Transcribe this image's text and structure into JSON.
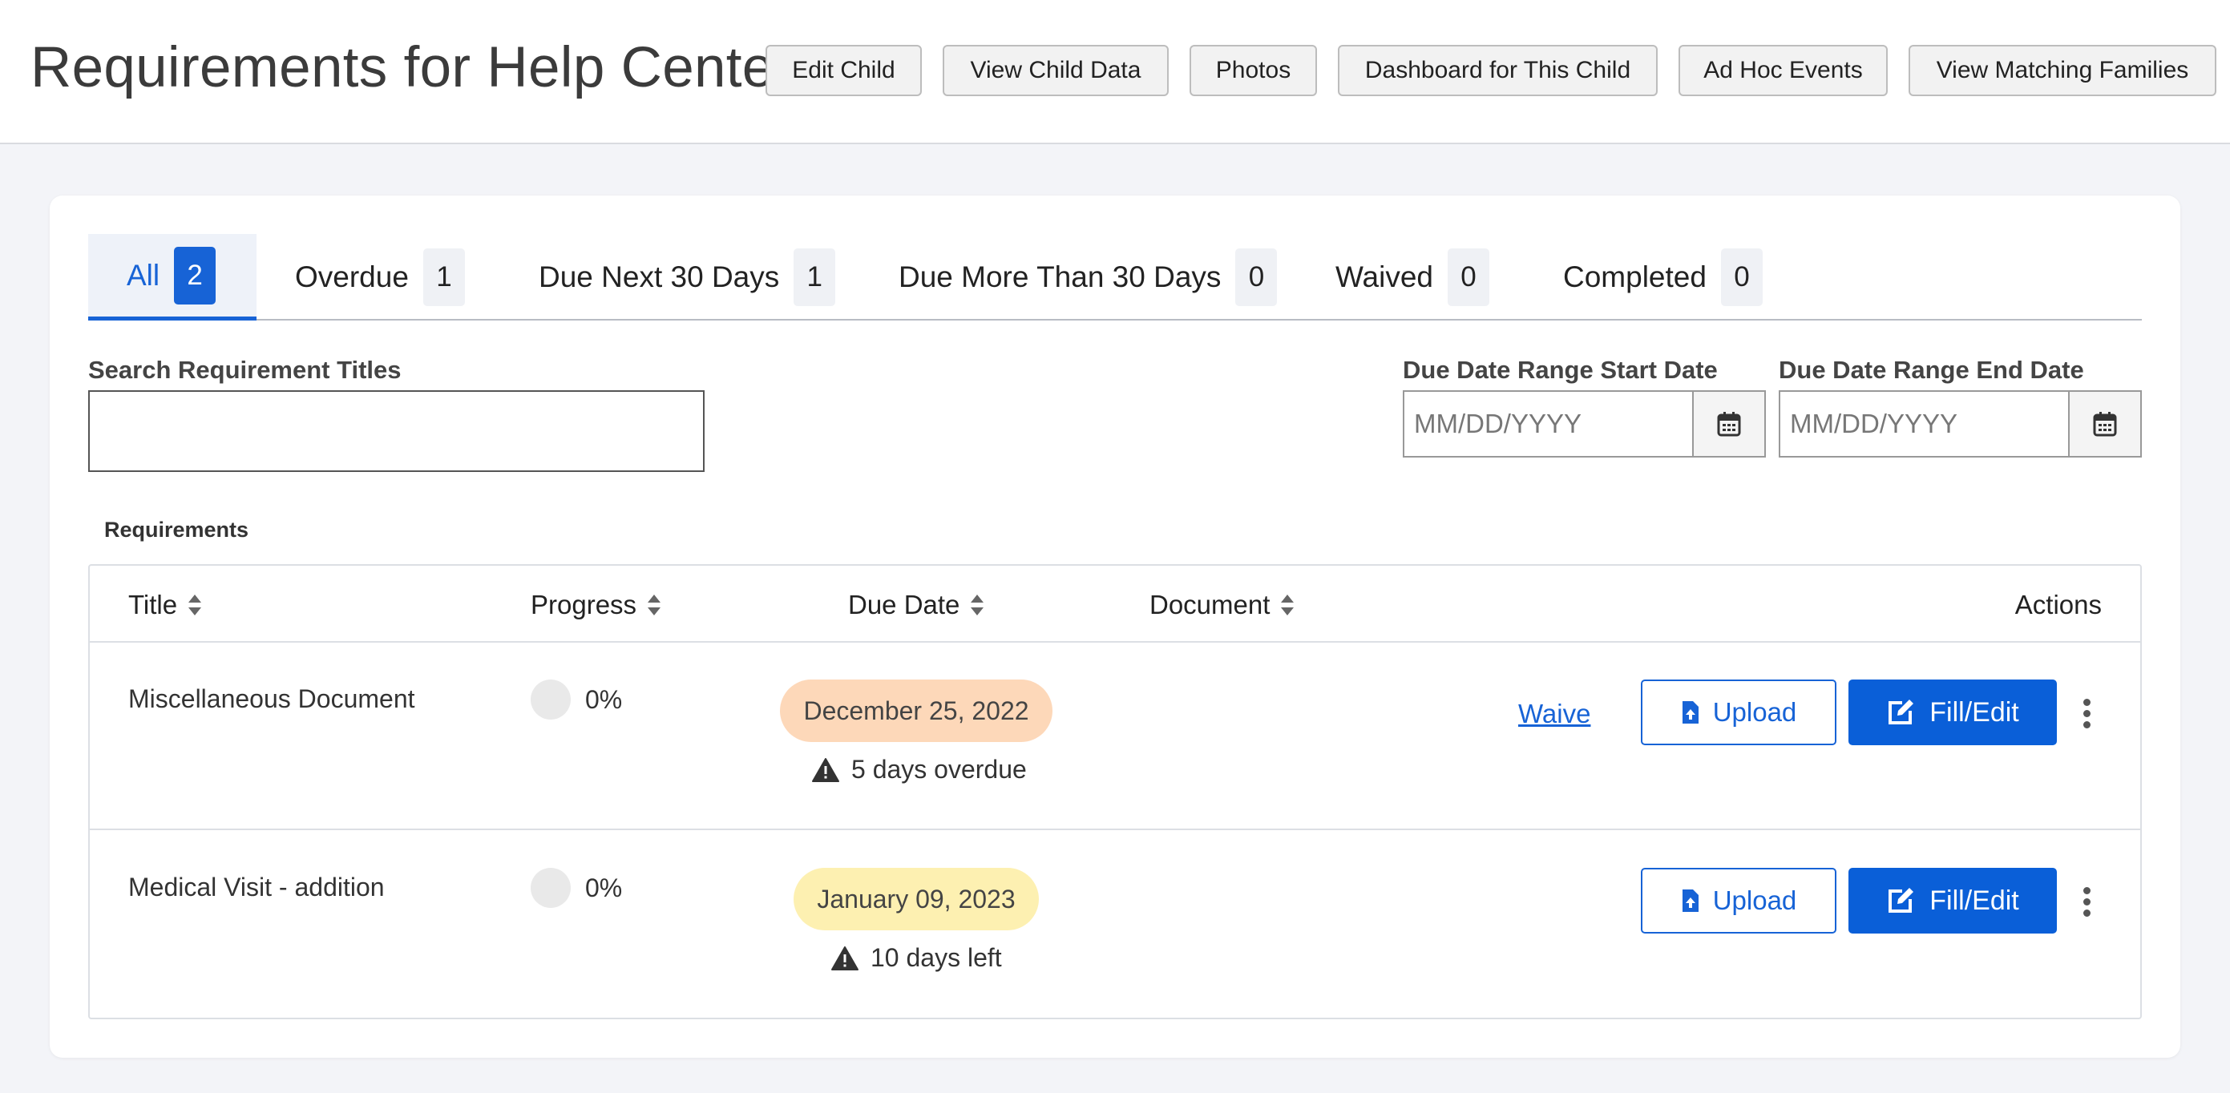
{
  "header": {
    "title": "Requirements for Help Center",
    "buttons": [
      "Edit Child",
      "View Child Data",
      "Photos",
      "Dashboard for This Child",
      "Ad Hoc Events",
      "View Matching Families"
    ]
  },
  "tabs": [
    {
      "label": "All",
      "count": "2",
      "active": true
    },
    {
      "label": "Overdue",
      "count": "1"
    },
    {
      "label": "Due Next 30 Days",
      "count": "1"
    },
    {
      "label": "Due More Than 30 Days",
      "count": "0"
    },
    {
      "label": "Waived",
      "count": "0"
    },
    {
      "label": "Completed",
      "count": "0"
    }
  ],
  "filters": {
    "search_label": "Search Requirement Titles",
    "search_value": "",
    "start_label": "Due Date Range Start Date",
    "start_placeholder": "MM/DD/YYYY",
    "end_label": "Due Date Range End Date",
    "end_placeholder": "MM/DD/YYYY"
  },
  "table": {
    "section_label": "Requirements",
    "columns": {
      "title": "Title",
      "progress": "Progress",
      "due_date": "Due Date",
      "document": "Document",
      "actions": "Actions"
    },
    "rows": [
      {
        "title": "Miscellaneous Document",
        "progress_value": 0,
        "progress": "0%",
        "due_date": "December 25, 2022",
        "due_color": "#fdd8b9",
        "due_note": "5 days overdue",
        "document": "",
        "waive_label": "Waive",
        "upload_label": "Upload",
        "fill_label": "Fill/Edit"
      },
      {
        "title": "Medical Visit - addition",
        "progress_value": 0,
        "progress": "0%",
        "due_date": "January 09, 2023",
        "due_color": "#fdf0b1",
        "due_note": "10 days left",
        "document": "",
        "upload_label": "Upload",
        "fill_label": "Fill/Edit"
      }
    ]
  },
  "colors": {
    "accent": "#1763d6",
    "overdue_badge": "#fdd8b9",
    "upcoming_badge": "#fdf0b1",
    "page_bg": "#f3f4f8"
  },
  "icons": {
    "calendar": "calendar-icon",
    "sort": "sort-icon",
    "warning": "warning-icon",
    "upload": "file-upload-icon",
    "edit": "edit-icon",
    "more": "kebab-menu-icon"
  }
}
